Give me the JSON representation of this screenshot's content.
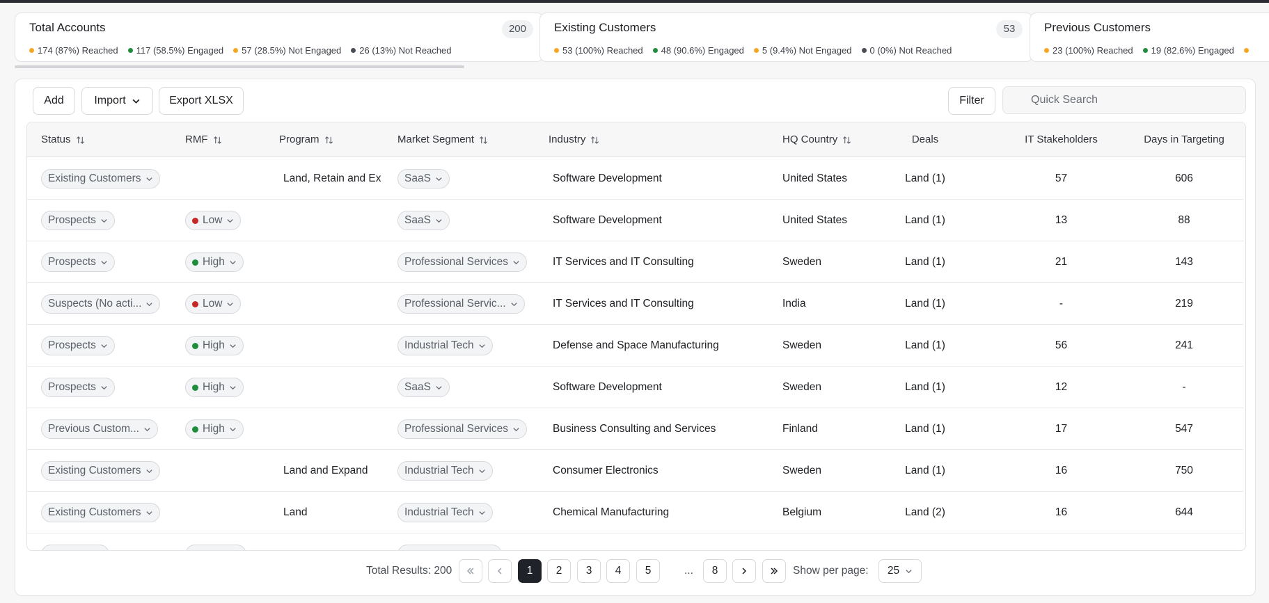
{
  "colors": {
    "reached": "#f5a623",
    "engaged": "#1e8e3e",
    "not_engaged": "#f5a623",
    "not_reached": "#4a4e55",
    "rmf_low": "#c62828",
    "rmf_high": "#1e8e3e"
  },
  "cards": [
    {
      "title": "Total Accounts",
      "count": "200",
      "stats": [
        "174 (87%) Reached",
        "117 (58.5%) Engaged",
        "57 (28.5%) Not Engaged",
        "26 (13%) Not Reached"
      ]
    },
    {
      "title": "Existing Customers",
      "count": "53",
      "stats": [
        "53 (100%) Reached",
        "48 (90.6%) Engaged",
        "5 (9.4%) Not Engaged",
        "0 (0%) Not Reached"
      ]
    },
    {
      "title": "Previous Customers",
      "count": "",
      "stats": [
        "23 (100%) Reached",
        "19 (82.6%) Engaged",
        "",
        ""
      ]
    }
  ],
  "toolbar": {
    "add_label": "Add",
    "import_label": "Import",
    "export_label": "Export XLSX",
    "filter_label": "Filter",
    "search_placeholder": "Quick Search"
  },
  "columns": [
    "Status",
    "RMF",
    "Program",
    "Market Segment",
    "Industry",
    "HQ Country",
    "Deals",
    "IT Stakeholders",
    "Days in Targeting"
  ],
  "rows": [
    {
      "status": "Existing Customers",
      "rmf": "",
      "rmf_level": "",
      "program": "Land, Retain and Ex",
      "segment": "SaaS",
      "industry": "Software Development",
      "country": "United States",
      "deals": "Land (1)",
      "stakeholders": "57",
      "days": "606"
    },
    {
      "status": "Prospects",
      "rmf": "Low",
      "rmf_level": "low",
      "program": "",
      "segment": "SaaS",
      "industry": "Software Development",
      "country": "United States",
      "deals": "Land (1)",
      "stakeholders": "13",
      "days": "88"
    },
    {
      "status": "Prospects",
      "rmf": "High",
      "rmf_level": "high",
      "program": "",
      "segment": "Professional Services",
      "industry": "IT Services and IT Consulting",
      "country": "Sweden",
      "deals": "Land (1)",
      "stakeholders": "21",
      "days": "143"
    },
    {
      "status": "Suspects (No acti...",
      "rmf": "Low",
      "rmf_level": "low",
      "program": "",
      "segment": "Professional Servic...",
      "industry": "IT Services and IT Consulting",
      "country": "India",
      "deals": "Land (1)",
      "stakeholders": "-",
      "days": "219"
    },
    {
      "status": "Prospects",
      "rmf": "High",
      "rmf_level": "high",
      "program": "",
      "segment": "Industrial Tech",
      "industry": "Defense and Space Manufacturing",
      "country": "Sweden",
      "deals": "Land (1)",
      "stakeholders": "56",
      "days": "241"
    },
    {
      "status": "Prospects",
      "rmf": "High",
      "rmf_level": "high",
      "program": "",
      "segment": "SaaS",
      "industry": "Software Development",
      "country": "Sweden",
      "deals": "Land (1)",
      "stakeholders": "12",
      "days": "-"
    },
    {
      "status": "Previous Custom...",
      "rmf": "High",
      "rmf_level": "high",
      "program": "",
      "segment": "Professional Services",
      "industry": "Business Consulting and Services",
      "country": "Finland",
      "deals": "Land (1)",
      "stakeholders": "17",
      "days": "547"
    },
    {
      "status": "Existing Customers",
      "rmf": "",
      "rmf_level": "",
      "program": "Land and Expand",
      "segment": "Industrial Tech",
      "industry": "Consumer Electronics",
      "country": "Sweden",
      "deals": "Land (1)",
      "stakeholders": "16",
      "days": "750"
    },
    {
      "status": "Existing Customers",
      "rmf": "",
      "rmf_level": "",
      "program": "Land",
      "segment": "Industrial Tech",
      "industry": "Chemical Manufacturing",
      "country": "Belgium",
      "deals": "Land (2)",
      "stakeholders": "16",
      "days": "644"
    }
  ],
  "pagination": {
    "total_label": "Total Results: 200",
    "pages": [
      "1",
      "2",
      "3",
      "4",
      "5",
      "8"
    ],
    "ellipsis": "...",
    "current": "1",
    "per_page_label": "Show per page:",
    "per_page": "25"
  }
}
